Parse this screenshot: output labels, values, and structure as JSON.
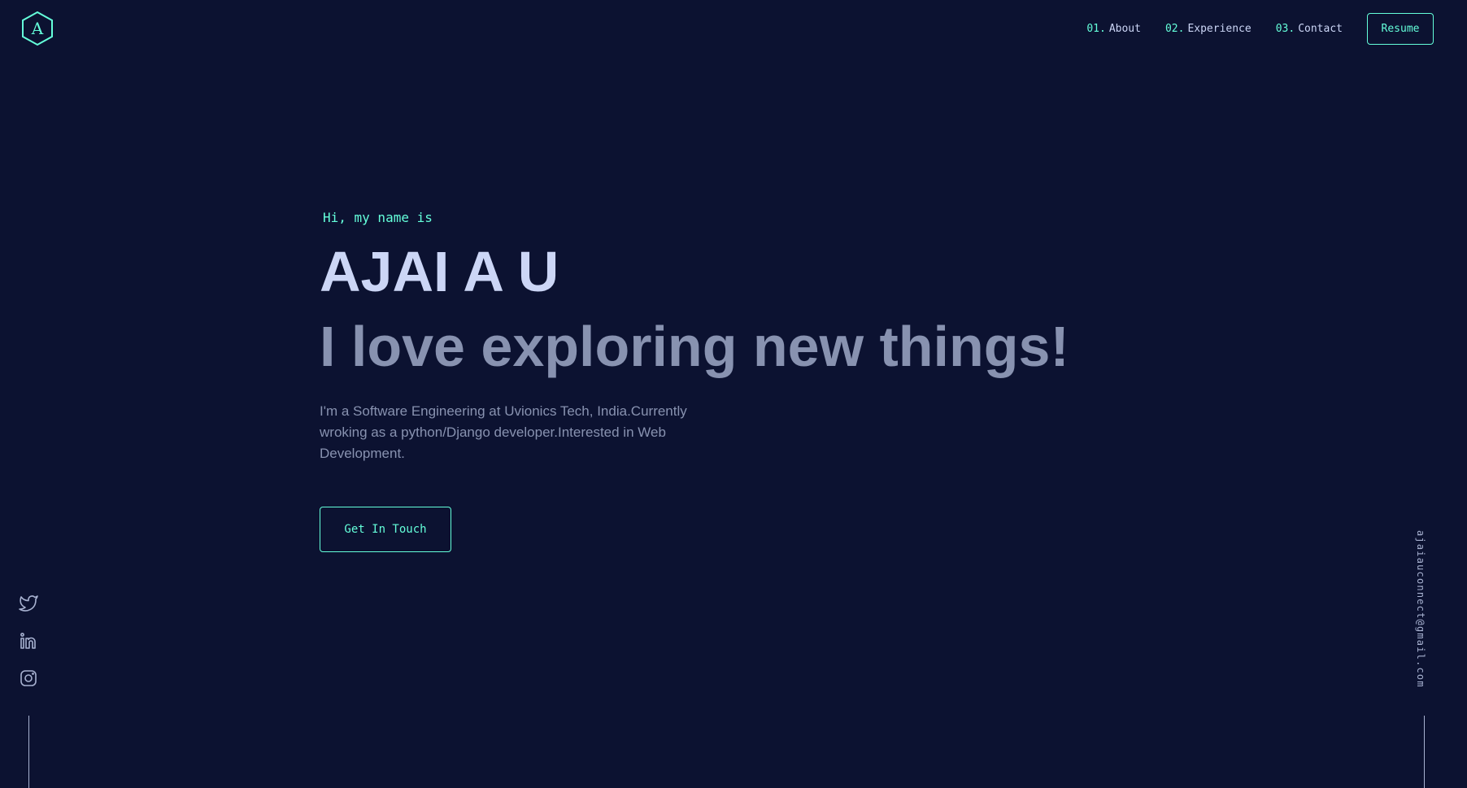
{
  "logo": {
    "letter": "A"
  },
  "nav": {
    "items": [
      {
        "num": "01.",
        "label": "About"
      },
      {
        "num": "02.",
        "label": "Experience"
      },
      {
        "num": "03.",
        "label": "Contact"
      }
    ],
    "resume_label": "Resume"
  },
  "hero": {
    "intro": "Hi, my name is",
    "name": "AJAI A U",
    "tagline": "I love exploring new things!",
    "bio": "I'm a Software Engineering at Uvionics Tech, India.Currently wroking as a python/Django developer.Interested in Web Development.",
    "cta_label": "Get In Touch"
  },
  "socials": [
    "twitter-icon",
    "linkedin-icon",
    "instagram-icon"
  ],
  "email": "ajaiauconnect@gmail.com",
  "colors": {
    "background": "#0c1231",
    "accent": "#64ffda",
    "heading": "#ccd6f6",
    "text": "#8892b0"
  }
}
